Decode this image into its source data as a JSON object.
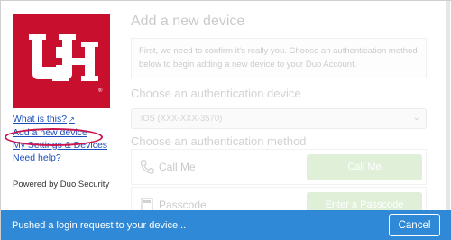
{
  "sidebar": {
    "links": {
      "what_is_this": "What is this?",
      "add_device": "Add a new device",
      "settings": "My Settings & Devices",
      "help": "Need help?"
    },
    "powered_by": "Powered by Duo Security"
  },
  "main": {
    "title": "Add a new device",
    "intro": "First, we need to confirm it's really you. Choose an authentication method below to begin adding a new device to your Duo Account.",
    "device_section_title": "Choose an authentication device",
    "device_select_value": "iOS (XXX-XXX-3570)",
    "method_section_title": "Choose an authentication method",
    "methods": [
      {
        "label": "Call Me",
        "button": "Call Me"
      },
      {
        "label": "Passcode",
        "button": "Enter a Passcode"
      }
    ]
  },
  "status_bar": {
    "message": "Pushed a login request to your device...",
    "cancel_label": "Cancel"
  },
  "colors": {
    "brand_red": "#c8102e",
    "status_blue": "#2f89d6",
    "button_green": "#b8dca8",
    "link_blue": "#1a4dbd",
    "highlight": "#c9144e"
  },
  "icons": {
    "external_link": "external-link-icon",
    "phone": "phone-icon",
    "passcode": "keypad-icon",
    "dropdown": "chevron-down-icon"
  }
}
